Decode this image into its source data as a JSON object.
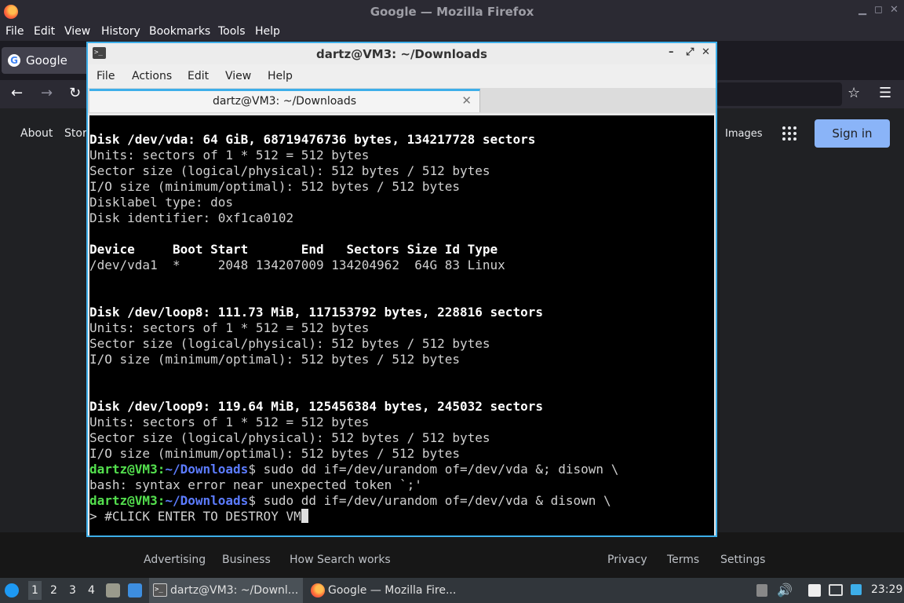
{
  "firefox": {
    "window_title": "Google — Mozilla Firefox",
    "window_controls": {
      "minimize": "▁",
      "maximize": "◻",
      "close": "✕"
    },
    "menu": [
      "File",
      "Edit",
      "View",
      "History",
      "Bookmarks",
      "Tools",
      "Help"
    ],
    "tab": {
      "title": "Google",
      "favicon": "G"
    },
    "nav": {
      "back": "←",
      "forward": "→",
      "reload": "↻",
      "bookmark_star": "☆",
      "app_menu": "☰"
    }
  },
  "google": {
    "top_links": {
      "about": "About",
      "store": "Store",
      "images": "Images"
    },
    "sign_in": "Sign in",
    "footer": {
      "left": [
        "Advertising",
        "Business",
        "How Search works"
      ],
      "right": [
        "Privacy",
        "Terms",
        "Settings"
      ]
    }
  },
  "terminal": {
    "window_title": "dartz@VM3: ~/Downloads",
    "window_controls": {
      "minimize": "–",
      "maximize": "⤢",
      "close": "✕"
    },
    "menu": [
      "File",
      "Actions",
      "Edit",
      "View",
      "Help"
    ],
    "tab_title": "dartz@VM3: ~/Downloads",
    "tab_close": "✕",
    "lines": [
      {
        "t": "Disk /dev/vda: 64 GiB, 68719476736 bytes, 134217728 sectors",
        "bold": true
      },
      {
        "t": "Units: sectors of 1 * 512 = 512 bytes"
      },
      {
        "t": "Sector size (logical/physical): 512 bytes / 512 bytes"
      },
      {
        "t": "I/O size (minimum/optimal): 512 bytes / 512 bytes"
      },
      {
        "t": "Disklabel type: dos"
      },
      {
        "t": "Disk identifier: 0xf1ca0102"
      },
      {
        "t": ""
      },
      {
        "t": "Device     Boot Start       End   Sectors Size Id Type",
        "bold": true
      },
      {
        "t": "/dev/vda1  *     2048 134207009 134204962  64G 83 Linux"
      },
      {
        "t": ""
      },
      {
        "t": ""
      },
      {
        "t": "Disk /dev/loop8: 111.73 MiB, 117153792 bytes, 228816 sectors",
        "bold": true
      },
      {
        "t": "Units: sectors of 1 * 512 = 512 bytes"
      },
      {
        "t": "Sector size (logical/physical): 512 bytes / 512 bytes"
      },
      {
        "t": "I/O size (minimum/optimal): 512 bytes / 512 bytes"
      },
      {
        "t": ""
      },
      {
        "t": ""
      },
      {
        "t": "Disk /dev/loop9: 119.64 MiB, 125456384 bytes, 245032 sectors",
        "bold": true
      },
      {
        "t": "Units: sectors of 1 * 512 = 512 bytes"
      },
      {
        "t": "Sector size (logical/physical): 512 bytes / 512 bytes"
      },
      {
        "t": "I/O size (minimum/optimal): 512 bytes / 512 bytes"
      },
      {
        "prompt": true,
        "user": "dartz@VM3",
        "path": "~/Downloads",
        "t": "$ sudo dd if=/dev/urandom of=/dev/vda &; disown \\"
      },
      {
        "t": "bash: syntax error near unexpected token `;'"
      },
      {
        "prompt": true,
        "user": "dartz@VM3",
        "path": "~/Downloads",
        "t": "$ sudo dd if=/dev/urandom of=/dev/vda & disown \\"
      },
      {
        "t": "> #CLICK ENTER TO DESTROY VM",
        "cursor": true
      }
    ]
  },
  "taskbar": {
    "workspaces": [
      "1",
      "2",
      "3",
      "4"
    ],
    "active_workspace": "1",
    "tasks": [
      {
        "label": "dartz@VM3: ~/Downl...",
        "icon": "terminal-icon"
      },
      {
        "label": "Google — Mozilla Fire...",
        "icon": "firefox-icon"
      }
    ],
    "clock": "23:29"
  }
}
